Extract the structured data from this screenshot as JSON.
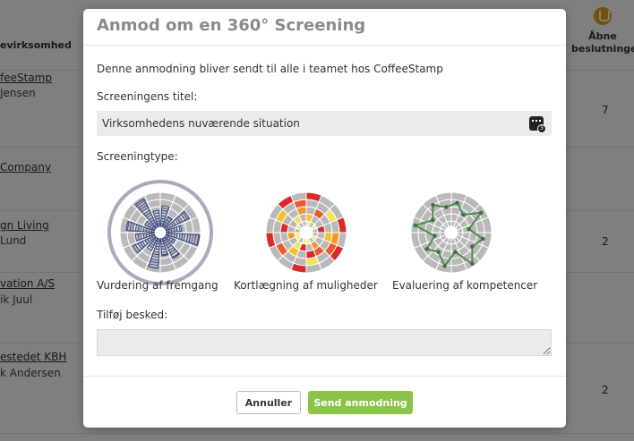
{
  "background": {
    "column_header": "evirksomhed",
    "right_header": "Åbne beslutninger",
    "rows": [
      {
        "company": "feeStamp",
        "person": "Jensen",
        "count": "7"
      },
      {
        "company": "Company",
        "person": "",
        "count": ""
      },
      {
        "company": "gn Living",
        "person": "Lund",
        "count": "2"
      },
      {
        "company": "vation A/S",
        "person": "ik Juul",
        "count": ""
      },
      {
        "company": "estedet KBH",
        "person": "k Andersen",
        "count": "2"
      }
    ]
  },
  "modal": {
    "title": "Anmod om en 360° Screening",
    "intro": "Denne anmodning bliver sendt til alle i teamet hos CoffeeStamp",
    "screening_title_label": "Screeningens titel:",
    "screening_title_value": "Virksomhedens nuværende situation",
    "type_label": "Screeningtype:",
    "types": [
      {
        "label": "Vurdering af fremgang",
        "selected": true
      },
      {
        "label": "Kortlægning af muligheder",
        "selected": false
      },
      {
        "label": "Evaluering af kompetencer",
        "selected": false
      }
    ],
    "message_label": "Tilføj besked:",
    "message_value": "",
    "cancel_label": "Annuller",
    "send_label": "Send anmodning"
  },
  "colors": {
    "send_button": "#8bc34a",
    "selected_ring": "#a8abbd",
    "progress_fill": "#3e4a82",
    "competence_line": "#4f8a4f"
  }
}
